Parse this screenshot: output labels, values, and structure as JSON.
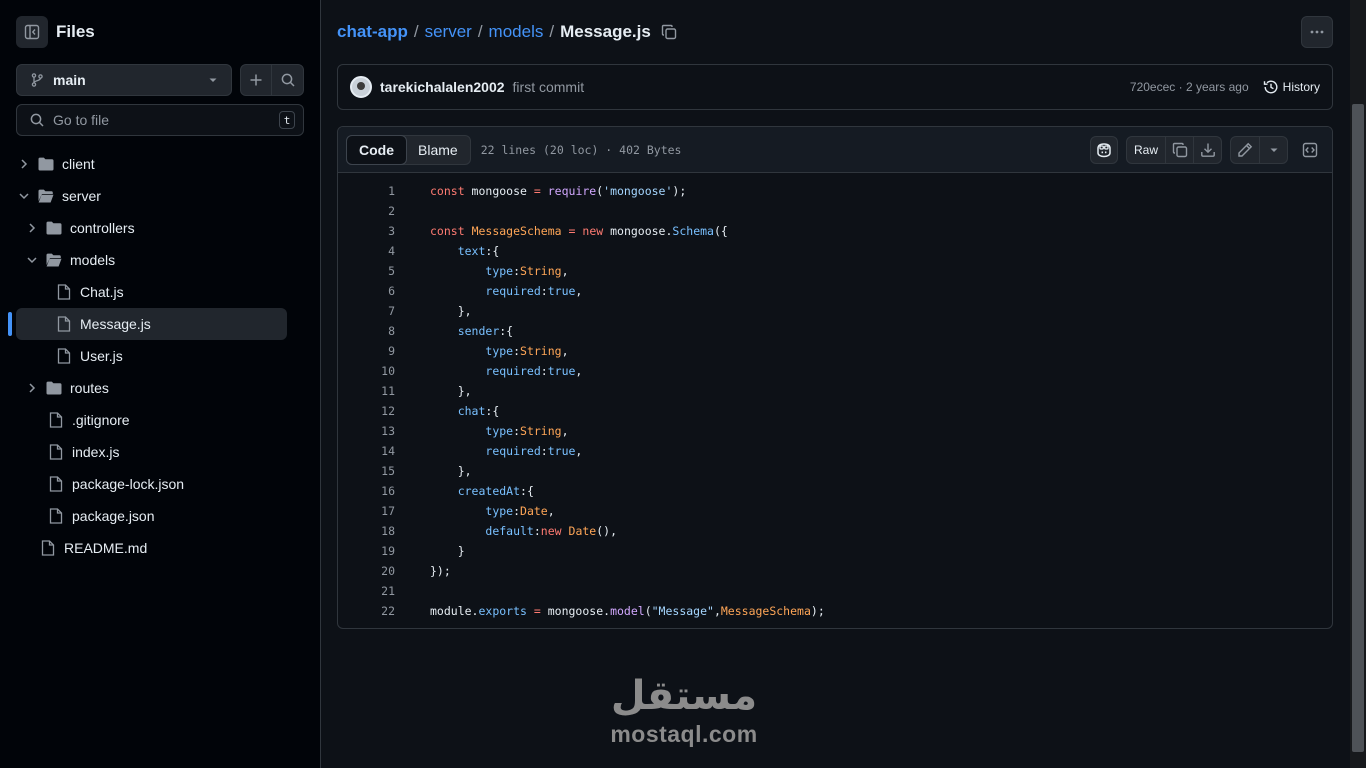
{
  "sidebar": {
    "title": "Files",
    "branch": "main",
    "goto_placeholder": "Go to file",
    "goto_shortcut": "t",
    "tree": [
      {
        "label": "client"
      },
      {
        "label": "server"
      },
      {
        "label": "controllers"
      },
      {
        "label": "models"
      },
      {
        "label": "Chat.js"
      },
      {
        "label": "Message.js"
      },
      {
        "label": "User.js"
      },
      {
        "label": "routes"
      },
      {
        "label": ".gitignore"
      },
      {
        "label": "index.js"
      },
      {
        "label": "package-lock.json"
      },
      {
        "label": "package.json"
      },
      {
        "label": "README.md"
      }
    ]
  },
  "breadcrumb": {
    "repo": "chat-app",
    "dir1": "server",
    "dir2": "models",
    "file": "Message.js",
    "separator": "/"
  },
  "commit": {
    "author": "tarekichalalen2002",
    "message": "first commit",
    "meta": "720ecec · 2 years ago",
    "history_label": "History"
  },
  "file_header": {
    "code_tab": "Code",
    "blame_tab": "Blame",
    "info": "22 lines (20 loc) · 402 Bytes",
    "raw_label": "Raw"
  },
  "watermark": {
    "arabic": "مستقل",
    "latin": "mostaql.com"
  },
  "colors": {
    "accent": "#4493f8",
    "keyword": "#ff7b72",
    "function": "#d2a8ff",
    "string": "#a5d6ff",
    "property": "#79c0ff",
    "variable": "#ffa657"
  }
}
